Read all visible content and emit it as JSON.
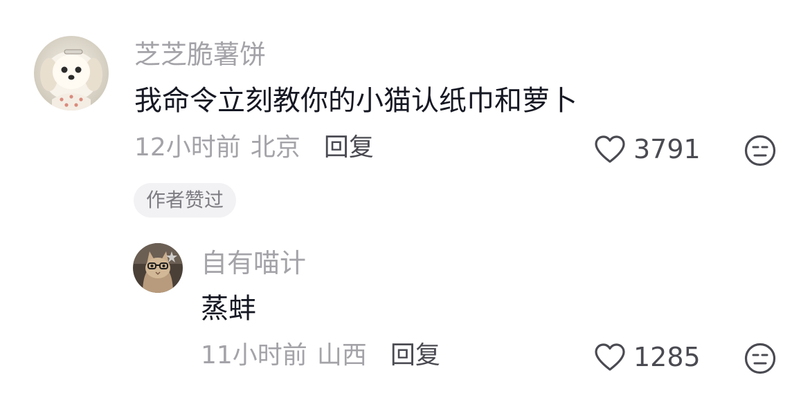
{
  "comment": {
    "avatar_icon": "fluffy-puppy-avatar",
    "username": "芝芝脆薯饼",
    "text": "我命令立刻教你的小猫认纸巾和萝卜",
    "time": "12小时前",
    "location": "北京",
    "reply_label": "回复",
    "likes": "3791",
    "badge": "作者赞过"
  },
  "reply": {
    "avatar_icon": "cat-with-glasses-avatar",
    "username": "自有喵计",
    "text": "蒸蚌",
    "time": "11小时前",
    "location": "山西",
    "reply_label": "回复",
    "likes": "1285"
  },
  "icons": {
    "like": "heart-icon",
    "dislike": "neutral-face-icon"
  },
  "colors": {
    "username": "#a3a3a8",
    "content": "#161823",
    "meta": "#a3a3a8",
    "reply_link": "#4a4a52",
    "badge_bg": "#f2f2f4"
  }
}
